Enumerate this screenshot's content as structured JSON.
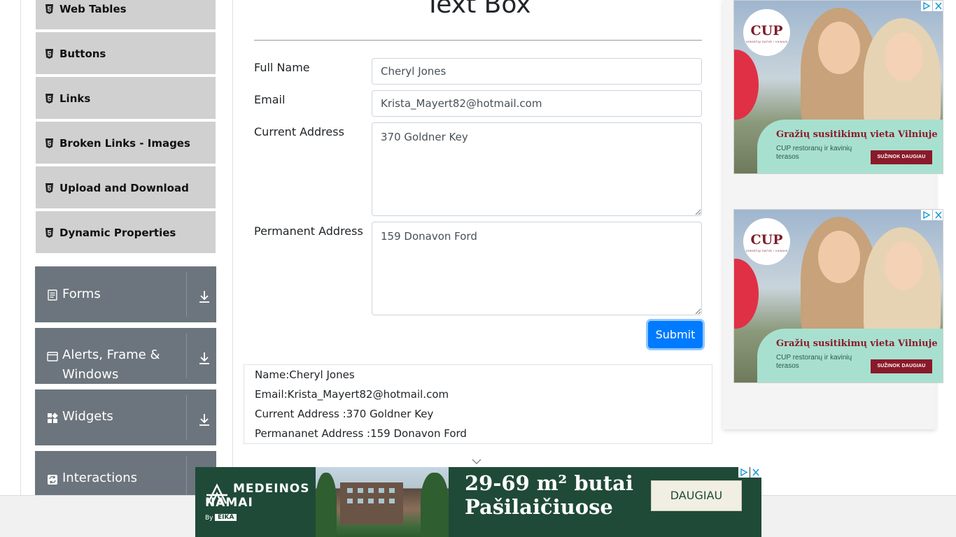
{
  "sidebar": {
    "elements_items": [
      {
        "label": "Web Tables"
      },
      {
        "label": "Buttons"
      },
      {
        "label": "Links"
      },
      {
        "label": "Broken Links - Images"
      },
      {
        "label": "Upload and Download"
      },
      {
        "label": "Dynamic Properties"
      }
    ],
    "groups": [
      {
        "label": "Forms",
        "icon": "form-icon"
      },
      {
        "label": "Alerts, Frame & Windows",
        "icon": "window-icon"
      },
      {
        "label": "Widgets",
        "icon": "widgets-icon"
      },
      {
        "label": "Interactions",
        "icon": "interactions-icon"
      }
    ]
  },
  "main": {
    "title": "Text Box",
    "form": {
      "full_name_label": "Full Name",
      "full_name_value": "Cheryl Jones",
      "email_label": "Email",
      "email_value": "Krista_Mayert82@hotmail.com",
      "current_address_label": "Current Address",
      "current_address_value": "370 Goldner Key",
      "permanent_address_label": "Permanent Address",
      "permanent_address_value": "159 Donavon Ford",
      "submit_label": "Submit"
    },
    "output": {
      "name": "Name:Cheryl Jones",
      "email": "Email:Krista_Mayert82@hotmail.com",
      "current_address": "Current Address :370 Goldner Key",
      "permanent_address": "Permananet Address :159 Donavon Ford"
    }
  },
  "ads": {
    "side": {
      "logo": "CUP",
      "logo_sub": "VOKIEČIŲ GATVĖ / VILNIUS",
      "headline": "Gražių susitikimų vieta Vilniuje",
      "subtext": "CUP restoranų ir kavinių terasos",
      "cta": "SUŽINOK DAUGIAU"
    },
    "banner": {
      "brand_line1": "MEDEINOS",
      "brand_line2": "NAMAI",
      "by": "By",
      "eika": "EIKA",
      "headline_line1": "29-69 m² butai",
      "headline_line2": "Pašilaičiuose",
      "cta": "DAUGIAU"
    }
  },
  "colors": {
    "primary": "#007bff",
    "sidebar_item_bg": "#d0d0d0",
    "group_bg": "#6c757d",
    "banner_bg": "#1f4a37",
    "ad_panel": "#a8e0cf",
    "ad_accent": "#8a1a2a"
  }
}
